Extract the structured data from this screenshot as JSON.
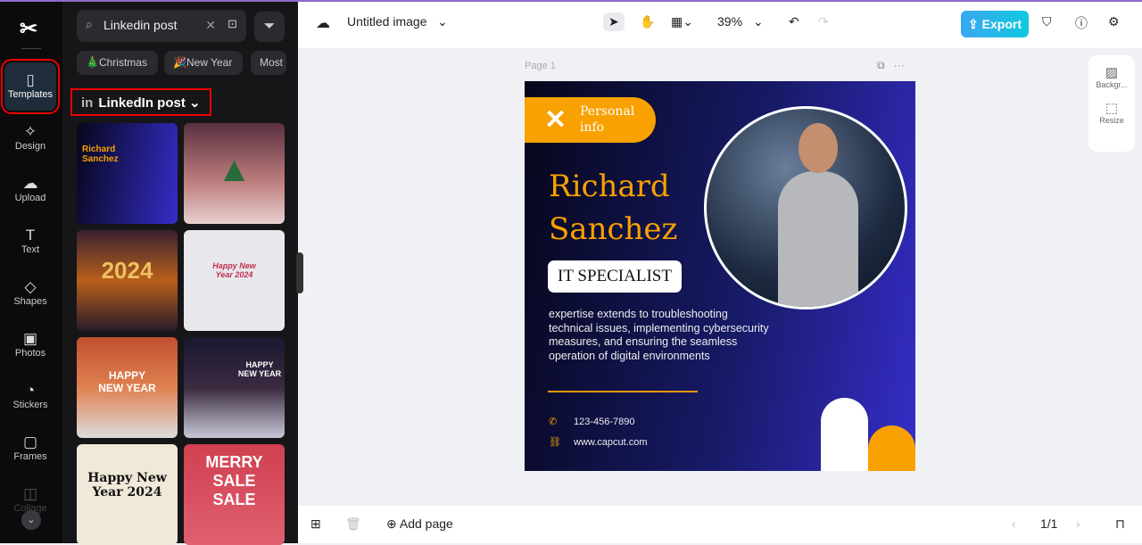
{
  "rail": {
    "items": [
      {
        "label": "Templates",
        "icon": "templates-icon"
      },
      {
        "label": "Design",
        "icon": "design-icon"
      },
      {
        "label": "Upload",
        "icon": "upload-icon"
      },
      {
        "label": "Text",
        "icon": "text-icon"
      },
      {
        "label": "Shapes",
        "icon": "shapes-icon"
      },
      {
        "label": "Photos",
        "icon": "photos-icon"
      },
      {
        "label": "Stickers",
        "icon": "stickers-icon"
      },
      {
        "label": "Frames",
        "icon": "frames-icon"
      },
      {
        "label": "Collage",
        "icon": "collage-icon"
      }
    ]
  },
  "panel": {
    "search_value": "Linkedin post",
    "chips": [
      "🎄Christmas",
      "🎉New Year",
      "Most"
    ],
    "category": "LinkedIn post",
    "category_icon": "in",
    "thumbs": [
      {
        "text": "Richard Sanchez"
      },
      {
        "text": ""
      },
      {
        "text": "2024"
      },
      {
        "text": "Happy New Year 2024"
      },
      {
        "text": "HAPPY NEW YEAR"
      },
      {
        "text": "HAPPY NEW YEAR"
      },
      {
        "text": "Happy New Year 2024"
      },
      {
        "text": "MERRY SALE SALE"
      }
    ]
  },
  "topbar": {
    "title": "Untitled image",
    "zoom": "39%",
    "export": "Export"
  },
  "side": {
    "background": "Backgr...",
    "resize": "Resize"
  },
  "page": {
    "label": "Page 1"
  },
  "design": {
    "pill": "Personal info",
    "name": "Richard Sanchez",
    "title": "IT SPECIALIST",
    "description": "expertise extends to troubleshooting technical issues, implementing cybersecurity measures, and ensuring the seamless operation of digital environments",
    "phone": "123-456-7890",
    "website": "www.capcut.com",
    "colors": {
      "orange": "#f8a100",
      "navy": "#171a66",
      "blue": "#352dc8"
    }
  },
  "bottom": {
    "add_page": "Add page",
    "pagination": "1/1"
  }
}
